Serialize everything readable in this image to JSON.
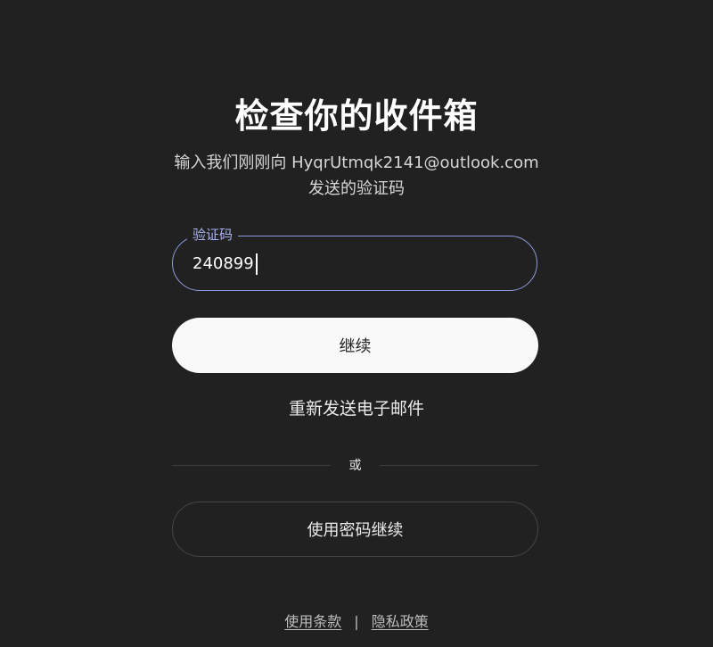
{
  "page": {
    "title": "检查你的收件箱",
    "subtitle_line1": "输入我们刚刚向 HyqrUtmqk2141@outlook.com",
    "subtitle_line2": "发送的验证码"
  },
  "form": {
    "code_label": "验证码",
    "code_value": "240899",
    "continue_label": "继续",
    "resend_label": "重新发送电子邮件",
    "divider_text": "或",
    "password_label": "使用密码继续"
  },
  "footer": {
    "terms_label": "使用条款",
    "separator": "|",
    "privacy_label": "隐私政策"
  },
  "colors": {
    "background": "#212121",
    "accent_border": "#8f9bdf",
    "primary_button": "#f9f9f9"
  }
}
